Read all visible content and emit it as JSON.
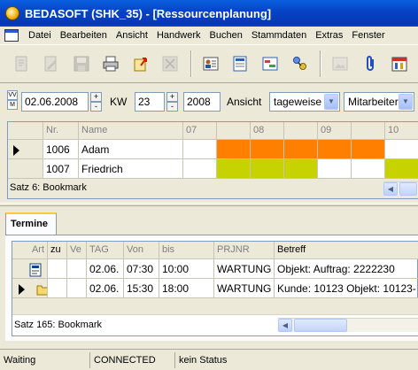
{
  "window": {
    "title": "BEDASOFT (SHK_35) - [Ressourcenplanung]"
  },
  "menu": [
    "Datei",
    "Bearbeiten",
    "Ansicht",
    "Handwerk",
    "Buchen",
    "Stammdaten",
    "Extras",
    "Fenster"
  ],
  "toolbar": {
    "buttons": [
      {
        "name": "new-record-icon",
        "enabled": false
      },
      {
        "name": "edit-record-icon",
        "enabled": false
      },
      {
        "name": "save-icon",
        "enabled": false
      },
      {
        "name": "print-icon",
        "enabled": true
      },
      {
        "name": "export-icon",
        "enabled": true
      },
      {
        "name": "cancel-icon",
        "enabled": false
      },
      {
        "name": "employee-card-icon",
        "enabled": true
      },
      {
        "name": "document-icon",
        "enabled": true
      },
      {
        "name": "schedule-icon",
        "enabled": true
      },
      {
        "name": "workflow-icon",
        "enabled": true
      },
      {
        "name": "image-icon",
        "enabled": false
      },
      {
        "name": "paperclip-icon",
        "enabled": true
      },
      {
        "name": "calendar-icon",
        "enabled": true
      }
    ]
  },
  "filters": {
    "vm_top": "VV",
    "vm_bottom": "M",
    "date": "02.06.2008",
    "spin_up": "+",
    "spin_down": "-",
    "kw_label": "KW",
    "kw_value": "23",
    "year": "2008",
    "view_label": "Ansicht",
    "view_value": "tageweise",
    "group_value": "Mitarbeiter"
  },
  "resource_grid": {
    "columns": [
      "Nr.",
      "Name",
      "07",
      "08",
      "09",
      "10"
    ],
    "rows": [
      {
        "nr": "1006",
        "name": "Adam"
      },
      {
        "nr": "1007",
        "name": "Friedrich"
      }
    ],
    "colors": {
      "orange": "#ff7f00",
      "yellow": "#c7d300",
      "white": "#ffffff"
    },
    "status": "Satz 6: Bookmark"
  },
  "termine": {
    "tab_label": "Termine",
    "columns": [
      "Art",
      "zu",
      "Ve",
      "TAG",
      "Von",
      "bis",
      "PRJNR",
      "Betreff"
    ],
    "rows": [
      {
        "art_icon": "note-icon",
        "tag": "02.06.",
        "von": "07:30",
        "bis": "10:00",
        "prjnr": "WARTUNG",
        "betreff": "Objekt: Auftrag: 2222230"
      },
      {
        "art_icon": "folder-icon",
        "tag": "02.06.",
        "von": "15:30",
        "bis": "18:00",
        "prjnr": "WARTUNG",
        "betreff": "Kunde: 10123 Objekt: 10123-"
      }
    ],
    "status": "Satz 165: Bookmark"
  },
  "statusbar": {
    "mode": "Waiting",
    "connection": "CONNECTED",
    "status": "kein Status"
  }
}
